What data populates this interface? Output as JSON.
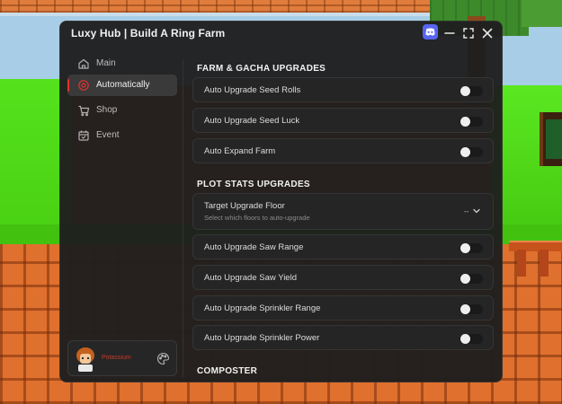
{
  "window": {
    "title": "Luxy Hub | Build A Ring Farm"
  },
  "titlebar_icons": [
    "discord-icon",
    "minimize-icon",
    "maximize-icon",
    "close-icon"
  ],
  "sidebar": {
    "items": [
      {
        "label": "Main",
        "icon": "home-icon",
        "active": false
      },
      {
        "label": "Automatically",
        "icon": "target-icon",
        "active": true
      },
      {
        "label": "Shop",
        "icon": "cart-icon",
        "active": false
      },
      {
        "label": "Event",
        "icon": "calendar-icon",
        "active": false
      }
    ],
    "profile": {
      "username": "Potassium",
      "settings_icon": "palette-icon"
    }
  },
  "main": {
    "sections": [
      {
        "title": "FARM & GACHA UPGRADES",
        "rows": [
          {
            "label": "Auto Upgrade Seed Rolls",
            "on": false
          },
          {
            "label": "Auto Upgrade Seed Luck",
            "on": false
          },
          {
            "label": "Auto Expand Farm",
            "on": false
          }
        ]
      },
      {
        "title": "PLOT STATS UPGRADES",
        "dropdown": {
          "label": "Target Upgrade Floor",
          "sublabel": "Select which floors to auto-upgrade",
          "value": "--"
        },
        "rows": [
          {
            "label": "Auto Upgrade Saw Range",
            "on": false
          },
          {
            "label": "Auto Upgrade Saw Yield",
            "on": false
          },
          {
            "label": "Auto Upgrade Sprinkler Range",
            "on": false
          },
          {
            "label": "Auto Upgrade Sprinkler Power",
            "on": false
          }
        ]
      },
      {
        "title": "COMPOSTER"
      }
    ]
  },
  "colors": {
    "accent": "#e0322f",
    "panel": "#1e1e1e",
    "row": "#252525",
    "discord": "#5865f2"
  }
}
